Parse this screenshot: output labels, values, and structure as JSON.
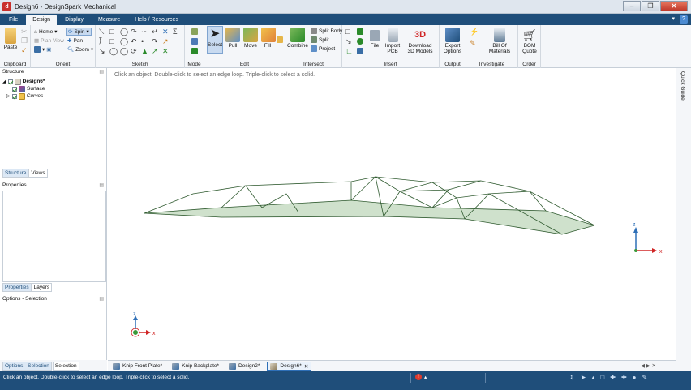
{
  "window": {
    "title": "Design6 - DesignSpark Mechanical",
    "app_icon": "designspark-logo-icon"
  },
  "menu_tabs": [
    {
      "label": "File",
      "active": false
    },
    {
      "label": "Design",
      "active": true
    },
    {
      "label": "Display",
      "active": false
    },
    {
      "label": "Measure",
      "active": false
    },
    {
      "label": "Help / Resources",
      "active": false
    }
  ],
  "ribbon": {
    "clipboard": {
      "label": "Clipboard",
      "paste": "Paste"
    },
    "orient": {
      "label": "Orient",
      "home": "Home",
      "spin": "Spin",
      "plan_view": "Plan View",
      "pan": "Pan",
      "zoom": "Zoom"
    },
    "sketch": {
      "label": "Sketch"
    },
    "mode": {
      "label": "Mode"
    },
    "edit": {
      "label": "Edit",
      "select": "Select",
      "pull": "Pull",
      "move": "Move",
      "fill": "Fill"
    },
    "intersect": {
      "label": "Intersect",
      "combine": "Combine",
      "split_body": "Split Body",
      "split": "Split",
      "project": "Project"
    },
    "insert": {
      "label": "Insert",
      "file": "File",
      "import_pcb": "Import PCB",
      "download_3d": "Download 3D Models"
    },
    "output": {
      "label": "Output",
      "export": "Export Options"
    },
    "investigate": {
      "label": "Investigate",
      "bom": "Bill Of Materials"
    },
    "order": {
      "label": "Order",
      "bom_quote": "BOM Quote"
    }
  },
  "structure": {
    "title": "Structure",
    "root": "Design6*",
    "children": [
      "Surface",
      "Curves"
    ]
  },
  "panel_tabs": {
    "structure": "Structure",
    "views": "Views"
  },
  "properties": {
    "title": "Properties"
  },
  "prop_tabs": {
    "properties": "Properties",
    "layers": "Layers"
  },
  "options": {
    "title": "Options - Selection"
  },
  "option_tabs": {
    "options": "Options - Selection",
    "selection": "Selection"
  },
  "viewport": {
    "hint": "Click an object. Double-click to select an edge loop. Triple-click to select a solid.",
    "axis_z": "z",
    "axis_x": "x"
  },
  "quick_guide": "Quick Guide",
  "doc_tabs": [
    {
      "label": "Knip Front Plate*",
      "active": false
    },
    {
      "label": "Knip Backplate*",
      "active": false
    },
    {
      "label": "Design2*",
      "active": false
    },
    {
      "label": "Design6*",
      "active": true
    }
  ],
  "status": {
    "message": "Click an object. Double-click to select an edge loop. Triple-click to select a solid.",
    "error_count": "!"
  },
  "colors": {
    "accent": "#1f4e7a",
    "surface_fill": "#cfe1cc",
    "surface_edge": "#2f5a2f"
  }
}
